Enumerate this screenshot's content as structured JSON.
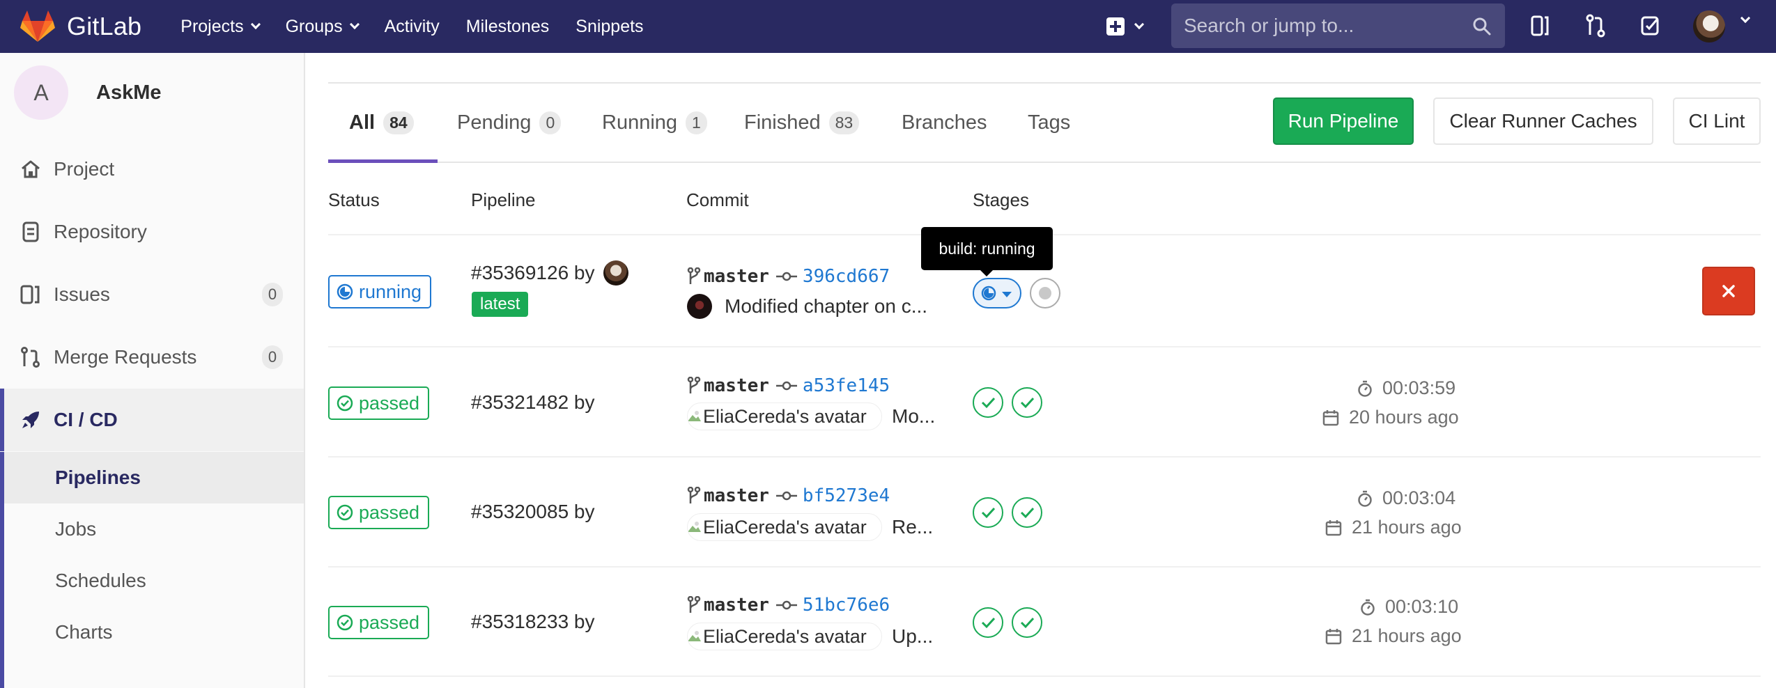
{
  "navbar": {
    "brand": "GitLab",
    "links": [
      {
        "label": "Projects"
      },
      {
        "label": "Groups"
      },
      {
        "label": "Activity"
      },
      {
        "label": "Milestones"
      },
      {
        "label": "Snippets"
      }
    ],
    "search_placeholder": "Search or jump to...",
    "colors": {
      "bg": "#292961",
      "search_bg": "#48487a"
    }
  },
  "sidebar": {
    "project_initial": "A",
    "project_name": "AskMe",
    "items": [
      {
        "label": "Project",
        "icon": "home-icon"
      },
      {
        "label": "Repository",
        "icon": "document-icon"
      },
      {
        "label": "Issues",
        "icon": "issues-icon",
        "badge": "0"
      },
      {
        "label": "Merge Requests",
        "icon": "merge-request-icon",
        "badge": "0"
      },
      {
        "label": "CI / CD",
        "icon": "rocket-icon",
        "active": true
      }
    ],
    "subitems": [
      {
        "label": "Pipelines",
        "active": true
      },
      {
        "label": "Jobs"
      },
      {
        "label": "Schedules"
      },
      {
        "label": "Charts"
      }
    ]
  },
  "tabs": [
    {
      "label": "All",
      "count": "84",
      "active": true
    },
    {
      "label": "Pending",
      "count": "0"
    },
    {
      "label": "Running",
      "count": "1"
    },
    {
      "label": "Finished",
      "count": "83"
    },
    {
      "label": "Branches"
    },
    {
      "label": "Tags"
    }
  ],
  "actions": {
    "run_pipeline": "Run Pipeline",
    "clear_caches": "Clear Runner Caches",
    "ci_lint": "CI Lint"
  },
  "table": {
    "headers": {
      "status": "Status",
      "pipeline": "Pipeline",
      "commit": "Commit",
      "stages": "Stages"
    },
    "tooltip": "build: running",
    "rows": [
      {
        "status": "running",
        "pipeline": "#35369126 by",
        "badge": "latest",
        "branch": "master",
        "sha": "396cd667",
        "message": "Modified chapter on c...",
        "stages": [
          "running",
          "created"
        ]
      },
      {
        "status": "passed",
        "pipeline": "#35321482 by",
        "branch": "master",
        "sha": "a53fe145",
        "avatar_alt": "EliaCereda's avatar",
        "message": "Mo...",
        "stages": [
          "passed",
          "passed"
        ],
        "duration": "00:03:59",
        "finished": "20 hours ago"
      },
      {
        "status": "passed",
        "pipeline": "#35320085 by",
        "branch": "master",
        "sha": "bf5273e4",
        "avatar_alt": "EliaCereda's avatar",
        "message": "Re...",
        "stages": [
          "passed",
          "passed"
        ],
        "duration": "00:03:04",
        "finished": "21 hours ago"
      },
      {
        "status": "passed",
        "pipeline": "#35318233 by",
        "branch": "master",
        "sha": "51bc76e6",
        "avatar_alt": "EliaCereda's avatar",
        "message": "Up...",
        "stages": [
          "passed",
          "passed"
        ],
        "duration": "00:03:10",
        "finished": "21 hours ago"
      }
    ]
  },
  "colors": {
    "success": "#1aaa55",
    "running": "#1f78d1",
    "danger": "#db3b21",
    "accent": "#6b4fbb"
  }
}
